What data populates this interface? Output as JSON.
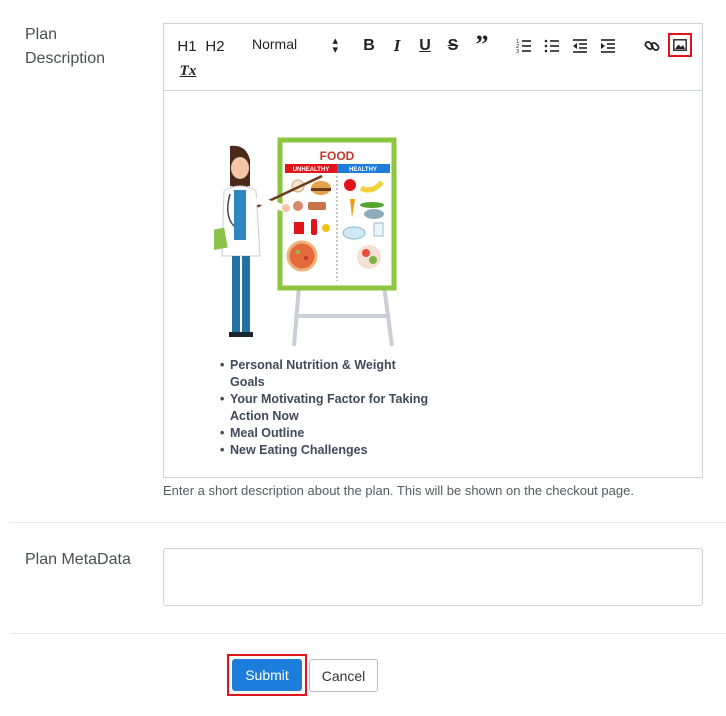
{
  "plan_description": {
    "label_line1": "Plan",
    "label_line2": "Description",
    "toolbar": {
      "h1": "H1",
      "h2": "H2",
      "format_select": "Normal",
      "bold": "B",
      "italic": "I",
      "underline": "U",
      "strike": "S",
      "quote": "”",
      "clear_format": "Tx"
    },
    "poster_title": "FOOD",
    "poster_left_tag": "UNHEALTHY",
    "poster_right_tag": "HEALTHY",
    "bullets": [
      "Personal Nutrition & Weight Goals",
      "Your Motivating Factor for Taking Action Now",
      "Meal Outline",
      "New Eating Challenges"
    ],
    "help_text": "Enter a short description about the plan. This will be shown on the checkout page."
  },
  "plan_metadata": {
    "label": "Plan MetaData",
    "value": ""
  },
  "actions": {
    "submit_label": "Submit",
    "cancel_label": "Cancel"
  },
  "colors": {
    "submit": "#1c7ddb",
    "highlight": "#e0141a",
    "poster_border": "#8cc63f"
  }
}
